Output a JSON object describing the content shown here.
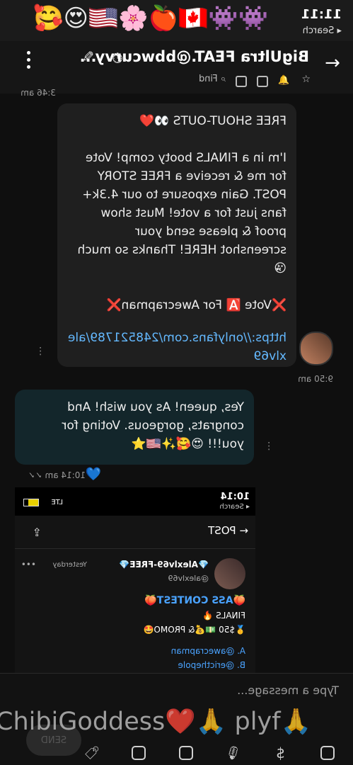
{
  "status_bar": {
    "time": "11:11",
    "back_label": "Search",
    "emoji_row": "👾👾🇨🇦🍎🌸🇺🇸😍🥰"
  },
  "header": {
    "title": "BigUltra FEAT.@bbwcurvy...",
    "find_label": "Find"
  },
  "messages": [
    {
      "text": "FREE SHOUT-OUTS 👀❤️\n\nI'm in a FINALS booty comp! Vote for me & receive a FREE STORY POST. Gain exposure to our 4.3k+ fans just for a vote! Must show proof & please send your screenshot HERE! Thanks so much 😘\n\n❌Vote 🅰️ For Awecrapman❌",
      "link": "https://onlyfans.com/248521789/alexlv69",
      "time": "9:50 am",
      "prev_time": "3:46 am"
    },
    {
      "text": "Yes, queen! As you wish! And congrats, gorgeous. Voting for you!!! 😍🥰✨🇺🇸⭐",
      "time": "10:14 am",
      "reaction": "💙"
    }
  ],
  "screenshot": {
    "time": "10:14",
    "back_label": "Search",
    "network": "LTE",
    "post_label": "POST",
    "author": "💎Alexlv69-FREE💎",
    "handle": "@alexlv69",
    "when": "Yesterday",
    "heading": "🍑ASS CONTEST🍑",
    "sub": "FINALS 🔥",
    "prize": "🥇$50 💵💰& PROMO🤩",
    "option_a": "A. @awecrapman",
    "option_b": "B. @ericthepole"
  },
  "composer": {
    "placeholder": "Type a message...",
    "send_label": "SEND",
    "overlay_text": "ChibiGoddess❤️🙏 plyf🙏"
  },
  "colors": {
    "accent": "#4aa3ff",
    "bubble_in": "#1f1f1f",
    "bubble_out": "#13262b",
    "link": "#64b9ff"
  }
}
